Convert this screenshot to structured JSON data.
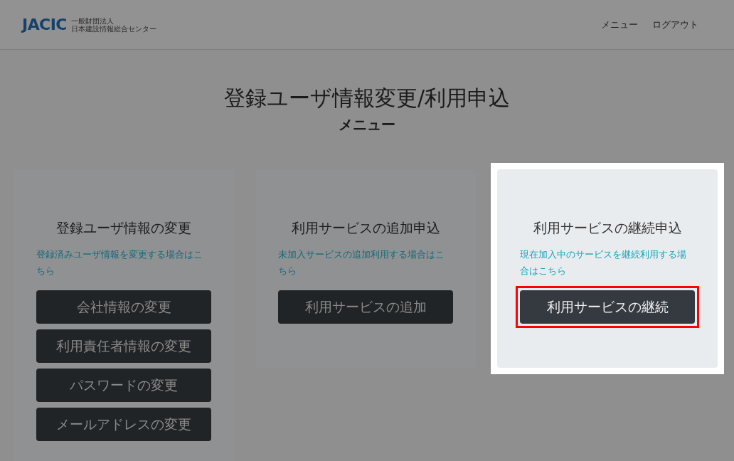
{
  "header": {
    "logo": "JACIC",
    "org_lines": [
      "一般財団法人",
      "日本建設情報総合センター"
    ],
    "nav": [
      "メニュー",
      "ログアウト"
    ]
  },
  "page_title": "登録ユーザ情報変更/利用申込",
  "subtitle": "メニュー",
  "cards": [
    {
      "title": "登録ユーザ情報の変更",
      "link": "登録済みユーザ情報を変更する場合はこちら",
      "highlighted": false,
      "buttons": [
        {
          "label": "会社情報の変更",
          "highlighted": false
        },
        {
          "label": "利用責任者情報の変更",
          "highlighted": false
        },
        {
          "label": "パスワードの変更",
          "highlighted": false
        },
        {
          "label": "メールアドレスの変更",
          "highlighted": false
        }
      ]
    },
    {
      "title": "利用サービスの追加申込",
      "link": "未加入サービスの追加利用する場合はこちら",
      "highlighted": false,
      "buttons": [
        {
          "label": "利用サービスの追加",
          "highlighted": false
        }
      ]
    },
    {
      "title": "利用サービスの継続申込",
      "link": "現在加入中のサービスを継続利用する場合はこちら",
      "highlighted": true,
      "buttons": [
        {
          "label": "利用サービスの継続",
          "highlighted": true
        }
      ]
    }
  ]
}
